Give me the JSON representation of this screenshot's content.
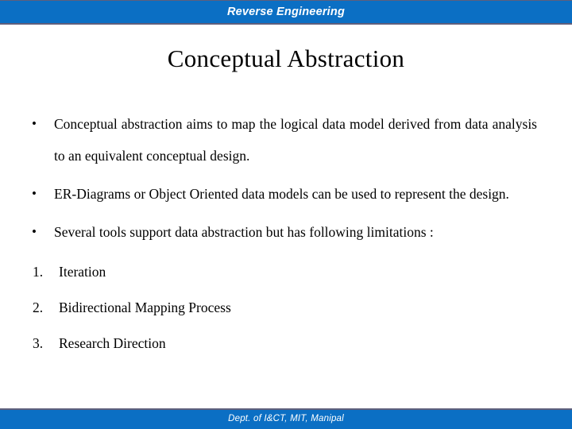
{
  "colors": {
    "band_blue": "#0B6FC4",
    "band_border": "#5F5F7C",
    "text_black": "#000000",
    "band_text": "#FFFFFF",
    "background": "#FFFFFF"
  },
  "header": {
    "title": "Reverse Engineering"
  },
  "slide": {
    "title": "Conceptual Abstraction",
    "bullets": [
      {
        "marker": "•",
        "text": "Conceptual abstraction aims to map the logical data model derived from data analysis to an equivalent conceptual design."
      },
      {
        "marker": "•",
        "text": "ER-Diagrams or Object Oriented data models can be used to represent the design."
      },
      {
        "marker": "•",
        "text": "Several tools support data abstraction but has following limitations :"
      }
    ],
    "numbered_items": [
      {
        "marker": "1.",
        "text": "Iteration"
      },
      {
        "marker": "2.",
        "text": "Bidirectional Mapping Process"
      },
      {
        "marker": "3.",
        "text": "Research Direction"
      }
    ]
  },
  "footer": {
    "text": "Dept. of I&CT, MIT, Manipal"
  }
}
